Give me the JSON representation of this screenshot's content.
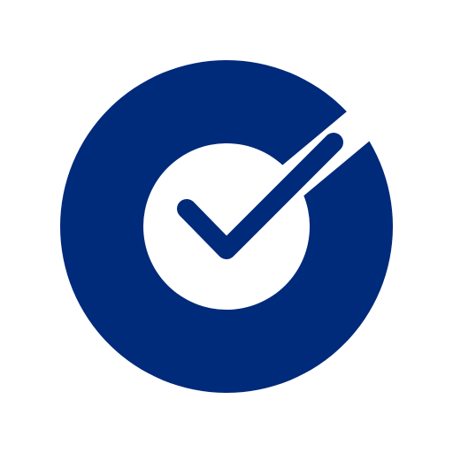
{
  "app_icon": {
    "icon": "checkmark-circle-icon",
    "colors": {
      "primary": "#002A7A",
      "background": "#FFFFFF"
    }
  }
}
